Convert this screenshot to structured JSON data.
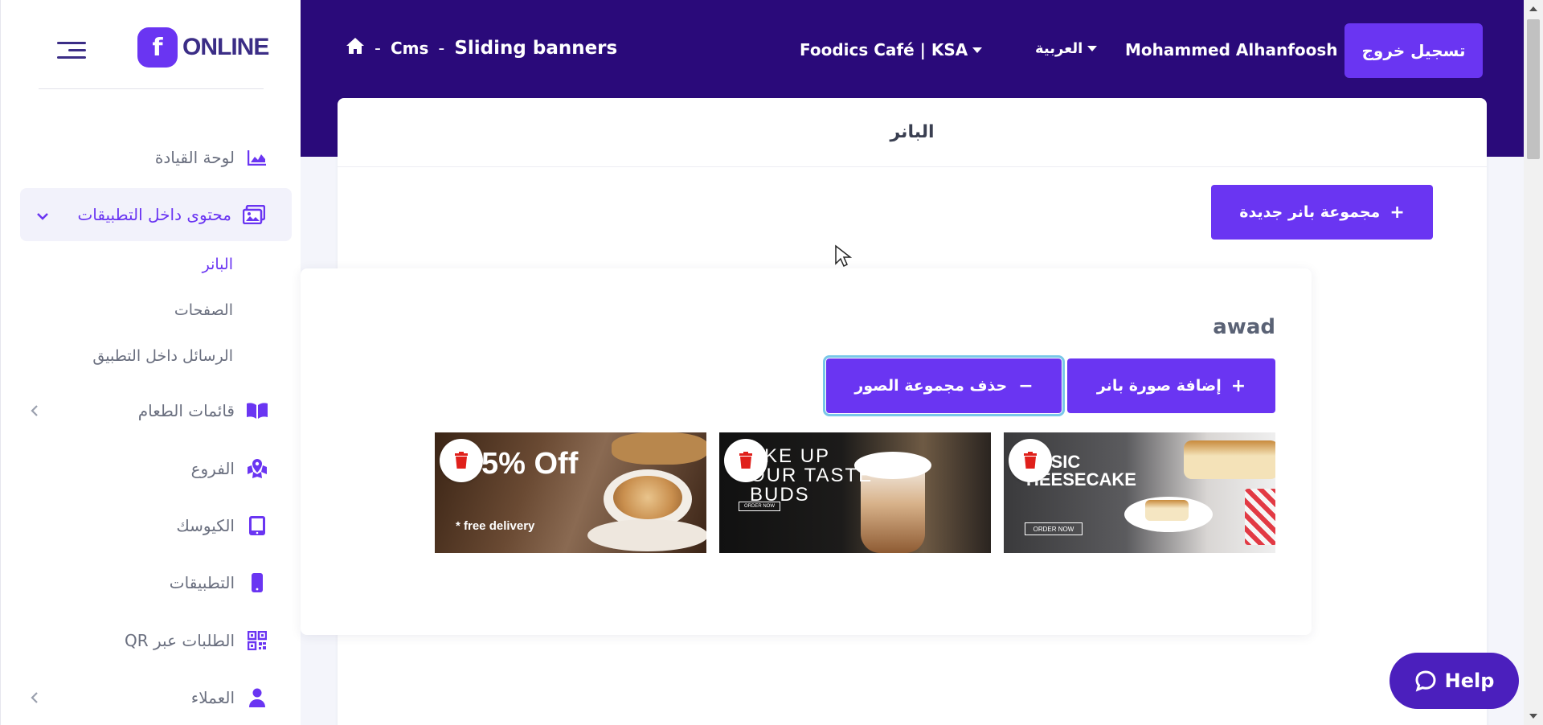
{
  "header": {
    "breadcrumb": {
      "home_icon": "home-icon",
      "sep1": "-",
      "section": "Cms",
      "sep2": "-",
      "page": "Sliding banners"
    },
    "business": "Foodics Café | KSA",
    "language": "العربية",
    "user_name": "Mohammed Alhanfoosh",
    "logout_label": "تسجيل خروج"
  },
  "brand": {
    "logo_letter": "f",
    "logo_text": "ONLINE"
  },
  "sidebar": {
    "items": [
      {
        "label": "لوحة القيادة",
        "icon": "chart-area-icon"
      },
      {
        "label": "محتوى داخل التطبيقات",
        "icon": "images-icon"
      },
      {
        "label": "قائمات الطعام",
        "icon": "book-open-icon"
      },
      {
        "label": "الفروع",
        "icon": "map-marked-icon"
      },
      {
        "label": "الكيوسك",
        "icon": "tablet-icon"
      },
      {
        "label": "التطبيقات",
        "icon": "mobile-icon"
      },
      {
        "label": "الطلبات عبر QR",
        "icon": "qrcode-icon"
      },
      {
        "label": "العملاء",
        "icon": "user-icon"
      }
    ],
    "subitems": [
      {
        "label": "البانر",
        "active": true
      },
      {
        "label": "الصفحات",
        "active": false
      },
      {
        "label": "الرسائل داخل التطبيق",
        "active": false
      }
    ]
  },
  "main": {
    "title": "البانر",
    "new_group_label": "مجموعة بانر جديدة",
    "groups": [
      {
        "name": "awad",
        "add_image_label": "إضافة صورة بانر",
        "delete_group_label": "حذف مجموعة الصور",
        "banners": [
          {
            "headline": "5% Off",
            "subline": "* free delivery"
          },
          {
            "headline": "AKE UP\nOUR TASTE\nBUDS",
            "cta": "ORDER NOW"
          },
          {
            "headline": "ASSIC\nHEESECAKE",
            "cta": "ORDER NOW"
          }
        ]
      }
    ]
  },
  "help": {
    "label": "Help"
  },
  "colors": {
    "header_bg": "#2a0a7a",
    "accent": "#6a35f2",
    "help_bg": "#4b1fbd",
    "delete_red": "#e0201b"
  }
}
